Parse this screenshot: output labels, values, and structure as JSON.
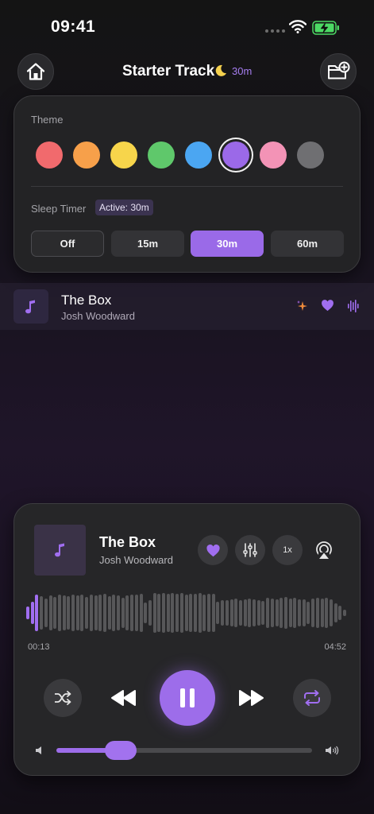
{
  "status": {
    "time": "09:41"
  },
  "header": {
    "title": "Starter Track",
    "timer_badge": "30m"
  },
  "theme_panel": {
    "theme_label": "Theme",
    "swatches": [
      "#f16a6d",
      "#f7a04a",
      "#f7d54b",
      "#5fc86b",
      "#4ba6f2",
      "#9b69e8",
      "#f393b6",
      "#6f6f72"
    ],
    "selected_index": 5,
    "sleep_label": "Sleep Timer",
    "active_badge": "Active: 30m",
    "timer_options": [
      "Off",
      "15m",
      "30m",
      "60m"
    ],
    "active_option_index": 2
  },
  "song_row": {
    "title": "The Box",
    "artist": "Josh Woodward"
  },
  "player": {
    "title": "The Box",
    "artist": "Josh Woodward",
    "speed": "1x",
    "current_time": "00:13",
    "total_time": "04:52",
    "progress": 0.046,
    "volume": 0.25,
    "accent_color": "#9d6dea",
    "waveform": [
      0.3,
      0.55,
      0.9,
      0.82,
      0.7,
      0.85,
      0.78,
      0.88,
      0.84,
      0.8,
      0.9,
      0.85,
      0.88,
      0.76,
      0.9,
      0.85,
      0.88,
      0.92,
      0.82,
      0.9,
      0.86,
      0.72,
      0.86,
      0.9,
      0.88,
      0.92,
      0.5,
      0.6,
      0.95,
      0.92,
      0.95,
      0.93,
      0.96,
      0.92,
      0.95,
      0.9,
      0.94,
      0.92,
      0.96,
      0.9,
      0.94,
      0.92,
      0.55,
      0.62,
      0.6,
      0.64,
      0.68,
      0.62,
      0.66,
      0.7,
      0.66,
      0.62,
      0.58,
      0.74,
      0.7,
      0.66,
      0.72,
      0.76,
      0.7,
      0.72,
      0.66,
      0.64,
      0.52,
      0.7,
      0.74,
      0.68,
      0.72,
      0.66,
      0.46,
      0.34,
      0.14
    ]
  }
}
